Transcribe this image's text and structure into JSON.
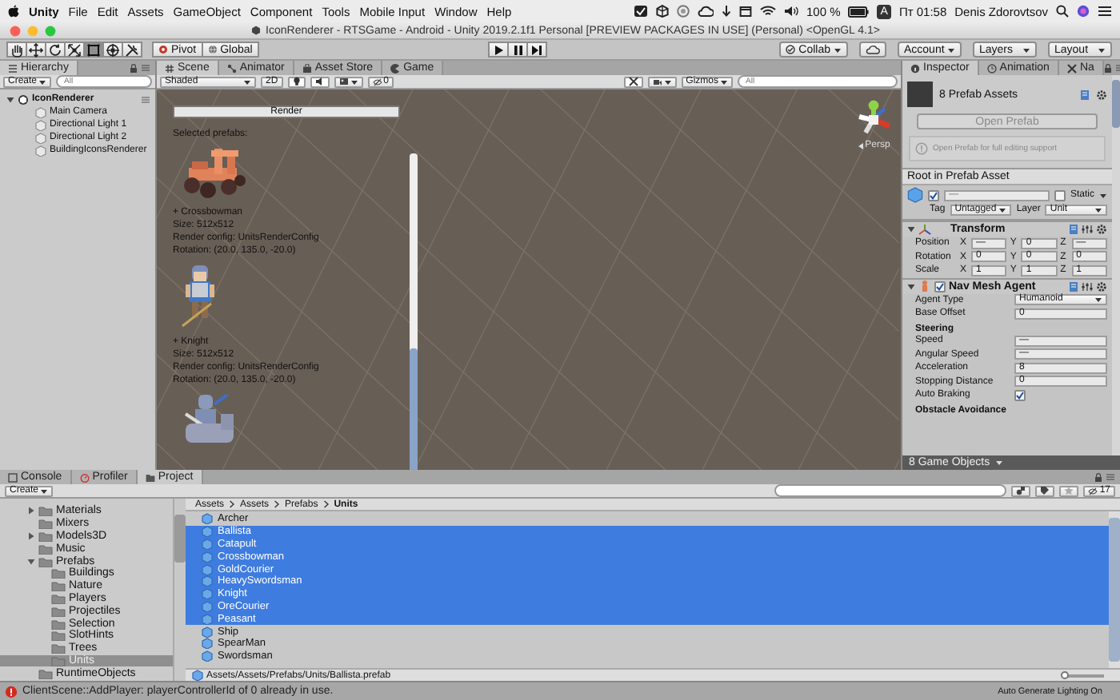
{
  "menubar": {
    "app": "Unity",
    "menus": [
      "File",
      "Edit",
      "Assets",
      "GameObject",
      "Component",
      "Tools",
      "Mobile Input",
      "Window",
      "Help"
    ],
    "battery": "100 %",
    "input_source": "A",
    "clock": "Пт 01:58",
    "user": "Denis Zdorovtsov"
  },
  "window": {
    "title": "IconRenderer - RTSGame - Android - Unity 2019.2.1f1 Personal [PREVIEW PACKAGES IN USE] (Personal) <OpenGL 4.1>"
  },
  "toolbar": {
    "tools": [
      {
        "selected": false
      },
      {
        "selected": false
      },
      {
        "selected": false
      },
      {
        "selected": false
      },
      {
        "selected": true
      },
      {
        "selected": false
      },
      {
        "selected": false
      }
    ],
    "pivot": "Pivot",
    "global": "Global",
    "collab": "Collab",
    "account": "Account",
    "layers": "Layers",
    "layout": "Layout"
  },
  "hierarchy": {
    "tab": "Hierarchy",
    "create": "Create",
    "search": {
      "placeholder": "All"
    },
    "items": [
      {
        "label": "IconRenderer",
        "expanded": true,
        "children": [
          {
            "label": "Main Camera"
          },
          {
            "label": "Directional Light 1"
          },
          {
            "label": "Directional Light 2"
          },
          {
            "label": "BuildingIconsRenderer"
          }
        ]
      }
    ]
  },
  "scene": {
    "tabs": [
      {
        "label": "Scene",
        "selected": true
      },
      {
        "label": "Animator",
        "selected": false
      },
      {
        "label": "Asset Store",
        "selected": false
      },
      {
        "label": "Game",
        "selected": false
      }
    ],
    "shading": "Shaded",
    "mode_2d": "2D",
    "lighting_on": true,
    "audio_on": true,
    "tools_on": true,
    "hidden_count": "0",
    "gizmos": "Gizmos",
    "search": {
      "placeholder": "All"
    },
    "projection": "Persp",
    "render_button": "Render",
    "heading": "Selected prefabs:",
    "prefabs": [
      {
        "name": "+ Crossbowman",
        "size": "Size: 512x512",
        "config": "Render config: UnitsRenderConfig",
        "rotation": "Rotation: (20.0, 135.0, -20.0)"
      },
      {
        "name": "+ Knight",
        "size": "Size: 512x512",
        "config": "Render config: UnitsRenderConfig",
        "rotation": "Rotation: (20.0, 135.0, -20.0)"
      }
    ]
  },
  "inspector": {
    "tabs": [
      {
        "label": "Inspector",
        "selected": true
      },
      {
        "label": "Animation",
        "selected": false
      },
      {
        "label": "Na",
        "selected": false
      }
    ],
    "title": "8 Prefab Assets",
    "open_prefab": {
      "label": "Open Prefab",
      "disabled": true
    },
    "info": "Open Prefab for full editing support",
    "root_label": "Root in Prefab Asset",
    "object": {
      "active": true,
      "name": "—",
      "static_label": "Static",
      "static": false,
      "tag_label": "Tag",
      "tag": "Untagged",
      "layer_label": "Layer",
      "layer": "Unit"
    },
    "components": [
      {
        "kind": "transform",
        "title": "Transform",
        "expanded": true,
        "rows": [
          {
            "kind": "vector",
            "label": "Position",
            "fields": [
              {
                "axis": "X",
                "value": "—"
              },
              {
                "axis": "Y",
                "value": "0"
              },
              {
                "axis": "Z",
                "value": "—"
              }
            ]
          },
          {
            "kind": "vector",
            "label": "Rotation",
            "fields": [
              {
                "axis": "X",
                "value": "0"
              },
              {
                "axis": "Y",
                "value": "0"
              },
              {
                "axis": "Z",
                "value": "0"
              }
            ]
          },
          {
            "kind": "vector",
            "label": "Scale",
            "fields": [
              {
                "axis": "X",
                "value": "1"
              },
              {
                "axis": "Y",
                "value": "1"
              },
              {
                "axis": "Z",
                "value": "1"
              }
            ]
          }
        ]
      },
      {
        "kind": "navmesh",
        "title": "Nav Mesh Agent",
        "enabled": true,
        "expanded": true,
        "rows": [
          {
            "kind": "dropdown",
            "label": "Agent Type",
            "value": "Humanoid"
          },
          {
            "kind": "field",
            "label": "Base Offset",
            "value": "0"
          },
          {
            "kind": "header",
            "label": "Steering"
          },
          {
            "kind": "field",
            "label": "Speed",
            "value": "—"
          },
          {
            "kind": "field",
            "label": "Angular Speed",
            "value": "—"
          },
          {
            "kind": "field",
            "label": "Acceleration",
            "value": "8"
          },
          {
            "kind": "field",
            "label": "Stopping Distance",
            "value": "0"
          },
          {
            "kind": "checkbox",
            "label": "Auto Braking",
            "checked": true
          },
          {
            "kind": "header",
            "label": "Obstacle Avoidance"
          }
        ]
      }
    ],
    "footer": "8 Game Objects"
  },
  "project": {
    "tabs": [
      {
        "label": "Console",
        "selected": false
      },
      {
        "label": "Profiler",
        "selected": false
      },
      {
        "label": "Project",
        "selected": true
      }
    ],
    "create": "Create",
    "hidden_count": "17",
    "folders": [
      {
        "label": "Materials",
        "expanded": false,
        "selected": false
      },
      {
        "label": "Mixers",
        "selected": false
      },
      {
        "label": "Models3D",
        "expanded": false,
        "selected": false
      },
      {
        "label": "Music",
        "selected": false
      },
      {
        "label": "Prefabs",
        "expanded": true,
        "selected": false,
        "children": [
          {
            "label": "Buildings",
            "selected": false
          },
          {
            "label": "Nature",
            "selected": false
          },
          {
            "label": "Players",
            "selected": false
          },
          {
            "label": "Projectiles",
            "selected": false
          },
          {
            "label": "Selection",
            "selected": false
          },
          {
            "label": "SlotHints",
            "selected": false
          },
          {
            "label": "Trees",
            "selected": false
          },
          {
            "label": "Units",
            "selected": true
          }
        ]
      },
      {
        "label": "RuntimeObjects",
        "selected": false
      }
    ],
    "breadcrumb": [
      "Assets",
      "Assets",
      "Prefabs",
      "Units"
    ],
    "files": [
      {
        "label": "Archer",
        "selected": false
      },
      {
        "label": "Ballista",
        "selected": true
      },
      {
        "label": "Catapult",
        "selected": true
      },
      {
        "label": "Crossbowman",
        "selected": true
      },
      {
        "label": "GoldCourier",
        "selected": true
      },
      {
        "label": "HeavySwordsman",
        "selected": true
      },
      {
        "label": "Knight",
        "selected": true
      },
      {
        "label": "OreCourier",
        "selected": true
      },
      {
        "label": "Peasant",
        "selected": true
      },
      {
        "label": "Ship",
        "selected": false
      },
      {
        "label": "SpearMan",
        "selected": false
      },
      {
        "label": "Swordsman",
        "selected": false
      }
    ],
    "path": "Assets/Assets/Prefabs/Units/Ballista.prefab",
    "icon_size": {
      "level": 0
    }
  },
  "status_bar": {
    "message": "ClientScene::AddPlayer: playerControllerId of 0 already in use.",
    "lighting": "Auto Generate Lighting On"
  }
}
